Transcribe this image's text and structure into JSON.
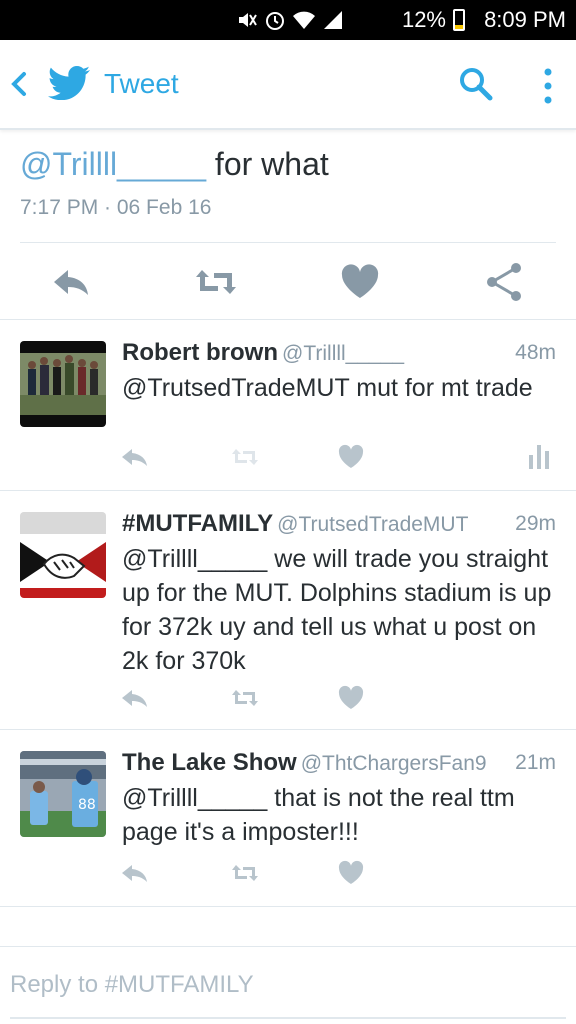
{
  "status_bar": {
    "battery_percent": "12%",
    "clock": "8:09 PM"
  },
  "appbar": {
    "title": "Tweet"
  },
  "main_tweet": {
    "mention": "@Trillll_____",
    "text": " for what",
    "timestamp": "7:17 PM · 06 Feb 16"
  },
  "replies": [
    {
      "name": "Robert brown",
      "handle": "@Trillll_____",
      "time": "48m",
      "text": "@TrutsedTradeMUT mut for mt trade"
    },
    {
      "name": "#MUTFAMILY",
      "handle": "@TrutsedTradeMUT",
      "time": "29m",
      "text": "@Trillll_____ we will trade you straight up for the MUT. Dolphins stadium is up for 372k uy and tell us what u post on 2k for 370k"
    },
    {
      "name": "The Lake Show",
      "handle": "@ThtChargersFan9",
      "time": "21m",
      "text": "@Trillll_____  that is not the real ttm page it's a imposter!!!"
    }
  ],
  "composer": {
    "placeholder": "Reply to #MUTFAMILY"
  },
  "colors": {
    "twitter_blue": "#2ea8e3",
    "icon_gray": "#8899a6",
    "light_icon_gray": "#b8c4cc",
    "mention_blue": "#66a9d6"
  }
}
